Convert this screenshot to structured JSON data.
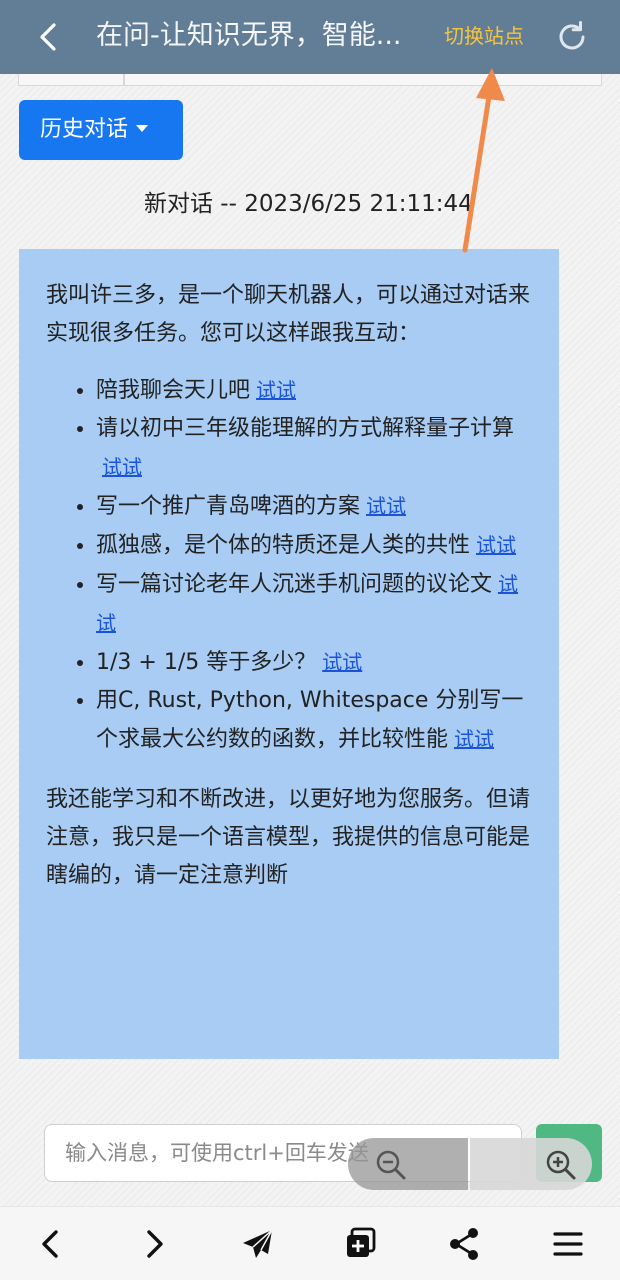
{
  "header": {
    "title": "在问-让知识无界，智能...",
    "switch_site": "切换站点",
    "icons": [
      "back-arrow-icon",
      "refresh-icon"
    ]
  },
  "history_button": "历史对话",
  "session_title": "新对话 -- 2023/6/25 21:11:44",
  "message": {
    "intro": "我叫许三多，是一个聊天机器人，可以通过对话来实现很多任务。您可以这样跟我互动：",
    "suggestions": [
      {
        "text": "陪我聊会天儿吧",
        "link": "试试"
      },
      {
        "text": "请以初中三年级能理解的方式解释量子计算",
        "link": "试试"
      },
      {
        "text": "写一个推广青岛啤酒的方案",
        "link": "试试"
      },
      {
        "text": "孤独感，是个体的特质还是人类的共性",
        "link": "试试"
      },
      {
        "text": "写一篇讨论老年人沉迷手机问题的议论文",
        "link": "试试"
      },
      {
        "text": "1/3 + 1/5 等于多少？",
        "link": "试试"
      },
      {
        "text": "用C, Rust, Python, Whitespace 分别写一个求最大公约数的函数，并比较性能",
        "link": "试试"
      }
    ],
    "outro": "我还能学习和不断改进，以更好地为您服务。但请注意，我只是一个语言模型，我提供的信息可能是瞎编的，请一定注意判断"
  },
  "input": {
    "placeholder": "输入消息，可使用ctrl+回车发送"
  },
  "bottom_nav": [
    "chevron-left-icon",
    "chevron-right-icon",
    "send-plane-icon",
    "tabs-icon",
    "share-icon",
    "menu-icon"
  ],
  "colors": {
    "header_bg": "#627d96",
    "switch_site": "#f5c542",
    "history_button_bg": "#1677f0",
    "message_bg": "#a8ccf3",
    "link": "#1a55d8",
    "send_button": "#4fb883",
    "annotation_arrow": "#f08a4b"
  }
}
